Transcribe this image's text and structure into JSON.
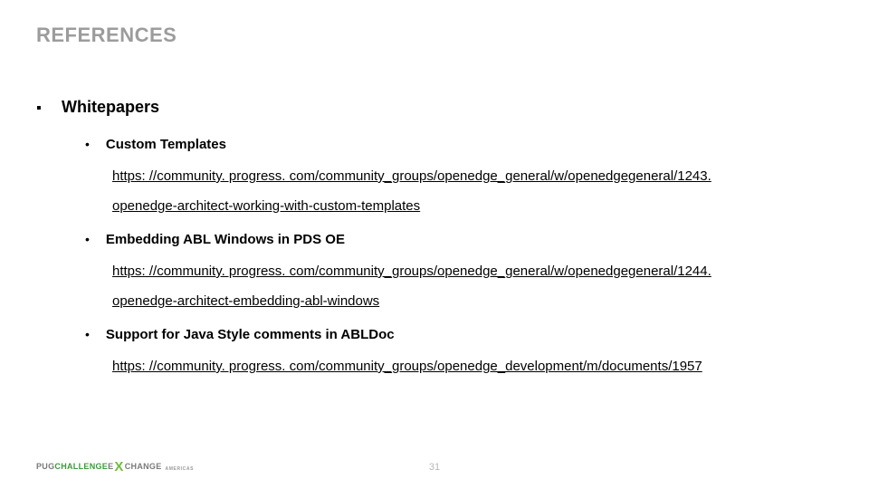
{
  "title": "REFERENCES",
  "l1_label": "Whitepapers",
  "items": [
    {
      "heading": "Custom Templates",
      "link_lines": [
        "https: //community. progress. com/community_groups/openedge_general/w/openedgegeneral/1243.",
        "openedge-architect-working-with-custom-templates"
      ]
    },
    {
      "heading": "Embedding ABL Windows in PDS OE",
      "link_lines": [
        "https: //community. progress. com/community_groups/openedge_general/w/openedgegeneral/1244.",
        "openedge-architect-embedding-abl-windows"
      ]
    },
    {
      "heading": "Support for Java Style comments in ABLDoc",
      "link_lines": [
        "https: //community. progress. com/community_groups/openedge_development/m/documents/1957"
      ]
    }
  ],
  "logo": {
    "pug": "PUG",
    "chal": "CHALLENGE",
    "e": "E",
    "x": "X",
    "change": "CHANGE",
    "sub": "AMERICAS"
  },
  "page_number": "31"
}
